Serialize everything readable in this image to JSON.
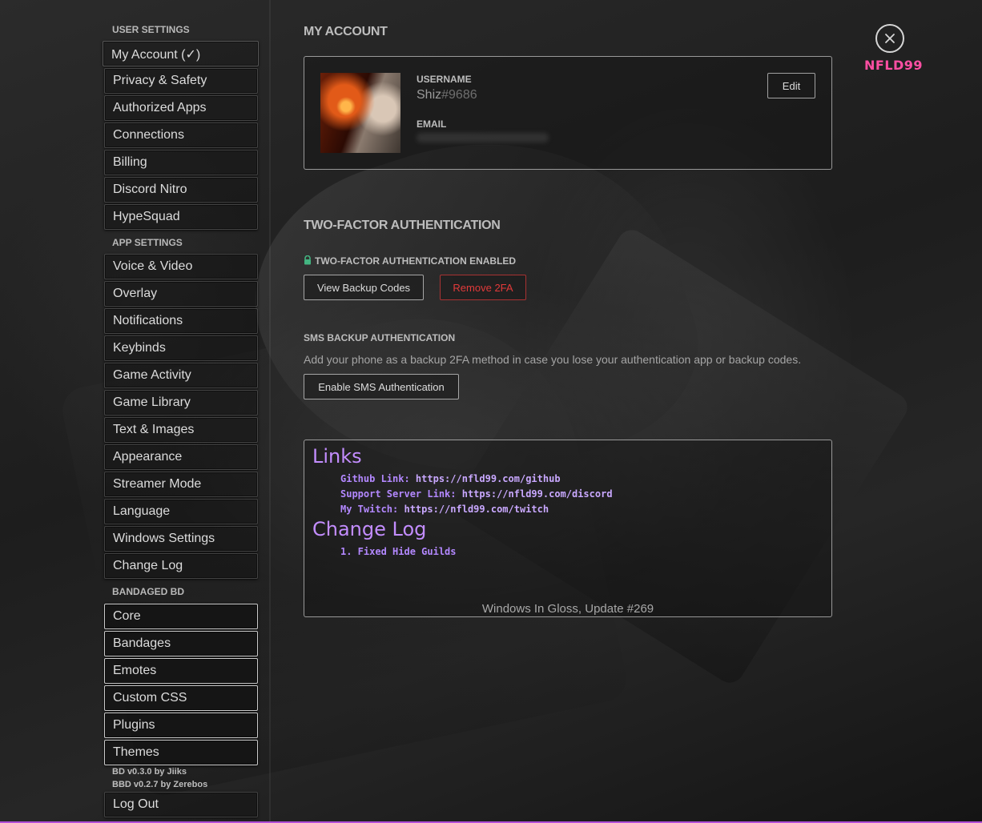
{
  "sidebar": {
    "user_settings_heading": "USER SETTINGS",
    "user_items": [
      {
        "label": "My Account (✓)"
      },
      {
        "label": "Privacy & Safety"
      },
      {
        "label": "Authorized Apps"
      },
      {
        "label": "Connections"
      },
      {
        "label": "Billing"
      },
      {
        "label": "Discord Nitro"
      },
      {
        "label": "HypeSquad"
      }
    ],
    "app_settings_heading": "APP SETTINGS",
    "app_items": [
      {
        "label": "Voice & Video"
      },
      {
        "label": "Overlay"
      },
      {
        "label": "Notifications"
      },
      {
        "label": "Keybinds"
      },
      {
        "label": "Game Activity"
      },
      {
        "label": "Game Library"
      },
      {
        "label": "Text & Images"
      },
      {
        "label": "Appearance"
      },
      {
        "label": "Streamer Mode"
      },
      {
        "label": "Language"
      },
      {
        "label": "Windows Settings"
      },
      {
        "label": "Change Log"
      }
    ],
    "bbd_heading": "BANDAGED BD",
    "bbd_items": [
      {
        "label": "Core"
      },
      {
        "label": "Bandages"
      },
      {
        "label": "Emotes"
      },
      {
        "label": "Custom CSS"
      },
      {
        "label": "Plugins"
      },
      {
        "label": "Themes"
      }
    ],
    "version_bd": "BD v0.3.0 by Jiiks",
    "version_bbd": "BBD v0.2.7 by Zerebos",
    "logout_label": "Log Out"
  },
  "account": {
    "title": "MY ACCOUNT",
    "username_label": "USERNAME",
    "username": "Shiz",
    "discriminator": "#9686",
    "email_label": "EMAIL",
    "edit_label": "Edit"
  },
  "two_factor": {
    "title": "TWO-FACTOR AUTHENTICATION",
    "enabled_label": "TWO-FACTOR AUTHENTICATION ENABLED",
    "view_backup_label": "View Backup Codes",
    "remove_label": "Remove 2FA"
  },
  "sms": {
    "title": "SMS BACKUP AUTHENTICATION",
    "description": "Add your phone as a backup 2FA method in case you lose your authentication app or backup codes.",
    "enable_label": "Enable SMS Authentication"
  },
  "info_box": {
    "links_title": "Links",
    "links": [
      {
        "prefix": "Github Link: ",
        "url": "https://nfld99.com/github"
      },
      {
        "prefix": "Support Server Link: ",
        "url": "https://nfld99.com/discord"
      },
      {
        "prefix": "My Twitch: ",
        "url": "https://nfld99.com/twitch"
      }
    ],
    "changelog_title": "Change Log",
    "changelog_items": [
      "1. Fixed Hide Guilds"
    ],
    "footer": "Windows In Gloss, Update #269"
  },
  "close": {
    "brand": "NFLD99",
    "icon": "close-icon",
    "brand_color": "#ff4fa3"
  },
  "colors": {
    "accent_purple": "#c38dff",
    "danger": "#e23a3a",
    "lock_green": "#43b581"
  }
}
